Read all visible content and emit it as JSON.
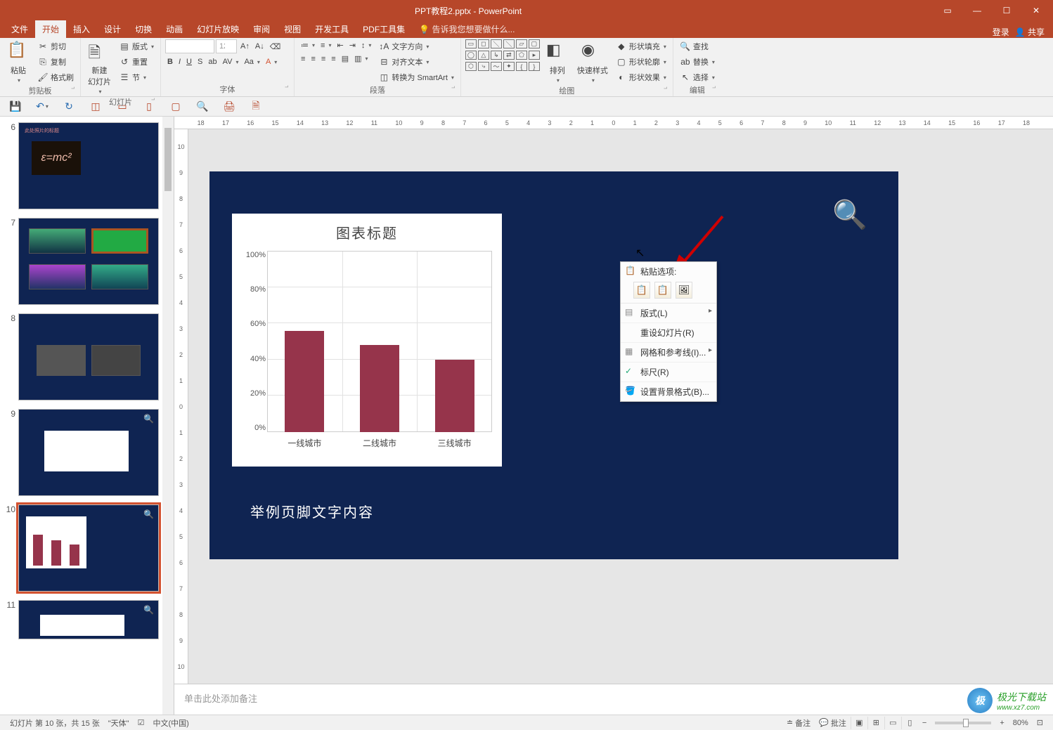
{
  "window": {
    "title": "PPT教程2.pptx - PowerPoint",
    "login": "登录",
    "share": "共享"
  },
  "tabs": {
    "file": "文件",
    "home": "开始",
    "insert": "插入",
    "design": "设计",
    "transition": "切换",
    "animation": "动画",
    "slideshow": "幻灯片放映",
    "review": "审阅",
    "view": "视图",
    "devtools": "开发工具",
    "pdf": "PDF工具集",
    "tell_me": "告诉我您想要做什么..."
  },
  "ribbon": {
    "clipboard": {
      "label": "剪贴板",
      "paste": "粘贴",
      "cut": "剪切",
      "copy": "复制",
      "format_painter": "格式刷"
    },
    "slides": {
      "label": "幻灯片",
      "new_slide": "新建\n幻灯片",
      "layout": "版式",
      "reset": "重置",
      "section": "节"
    },
    "font": {
      "label": "字体",
      "size_val": "12",
      "name_val": ""
    },
    "paragraph": {
      "label": "段落",
      "text_dir": "文字方向",
      "align_text": "对齐文本",
      "smartart": "转换为 SmartArt"
    },
    "drawing": {
      "label": "绘图",
      "arrange": "排列",
      "quick_styles": "快速样式",
      "shape_fill": "形状填充",
      "shape_outline": "形状轮廓",
      "shape_effects": "形状效果"
    },
    "editing": {
      "label": "编辑",
      "find": "查找",
      "replace": "替换",
      "select": "选择"
    }
  },
  "thumbs": {
    "n6": "6",
    "n7": "7",
    "n8": "8",
    "n9": "9",
    "n10": "10",
    "n11": "11",
    "t6_title": "此处照片的标题",
    "t6_formula": "ε=mc²"
  },
  "ruler_h": [
    "18",
    "17",
    "16",
    "15",
    "14",
    "13",
    "12",
    "11",
    "10",
    "9",
    "8",
    "7",
    "6",
    "5",
    "4",
    "3",
    "2",
    "1",
    "0",
    "1",
    "2",
    "3",
    "4",
    "5",
    "6",
    "7",
    "8",
    "9",
    "10",
    "11",
    "12",
    "13",
    "14",
    "15",
    "16",
    "17",
    "18"
  ],
  "ruler_v": [
    "10",
    "9",
    "8",
    "7",
    "6",
    "5",
    "4",
    "3",
    "2",
    "1",
    "0",
    "1",
    "2",
    "3",
    "4",
    "5",
    "6",
    "7",
    "8",
    "9",
    "10"
  ],
  "slide": {
    "footer_text": "举例页脚文字内容"
  },
  "chart_data": {
    "type": "bar",
    "title": "图表标题",
    "categories": [
      "一线城市",
      "二线城市",
      "三线城市"
    ],
    "values": [
      56,
      48,
      40
    ],
    "ylim": [
      0,
      100
    ],
    "yticks": [
      "0%",
      "20%",
      "40%",
      "60%",
      "80%",
      "100%"
    ],
    "xlabel": "",
    "ylabel": ""
  },
  "context_menu": {
    "paste_options": "粘贴选项:",
    "layout": "版式(L)",
    "reset_slide": "重设幻灯片(R)",
    "grid_guides": "网格和参考线(I)...",
    "ruler": "标尺(R)",
    "format_bg": "设置背景格式(B)..."
  },
  "notes": {
    "placeholder": "单击此处添加备注"
  },
  "status": {
    "slide_info": "幻灯片 第 10 张，共 15 张",
    "theme": "\"天体\"",
    "lang": "中文(中国)",
    "notes_btn": "备注",
    "comments_btn": "批注",
    "zoom": "80%"
  },
  "watermark": {
    "text": "极光下载站",
    "url": "www.xz7.com"
  }
}
